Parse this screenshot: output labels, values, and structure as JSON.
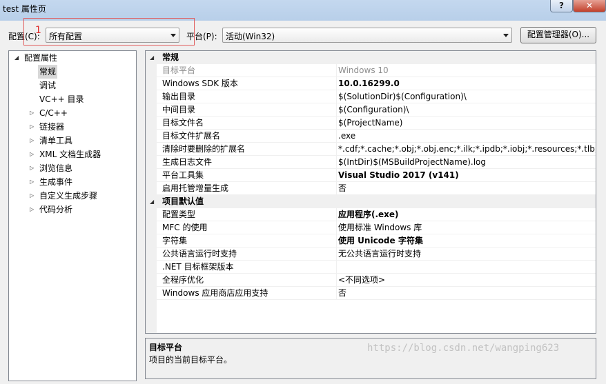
{
  "window": {
    "title": "test 属性页",
    "help_label": "?",
    "close_label": "✕"
  },
  "toolbar": {
    "config_label": "配置(C):",
    "config_value": "所有配置",
    "platform_label": "平台(P):",
    "platform_value": "活动(Win32)",
    "manager_button": "配置管理器(O)...",
    "annotation": "1"
  },
  "tree": {
    "items": [
      {
        "label": "配置属性",
        "expander": "◢"
      },
      {
        "label": "常规"
      },
      {
        "label": "调试"
      },
      {
        "label": "VC++ 目录"
      },
      {
        "label": "C/C++",
        "expander": "▷"
      },
      {
        "label": "链接器",
        "expander": "▷"
      },
      {
        "label": "清单工具",
        "expander": "▷"
      },
      {
        "label": "XML 文档生成器",
        "expander": "▷"
      },
      {
        "label": "浏览信息",
        "expander": "▷"
      },
      {
        "label": "生成事件",
        "expander": "▷"
      },
      {
        "label": "自定义生成步骤",
        "expander": "▷"
      },
      {
        "label": "代码分析",
        "expander": "▷"
      }
    ]
  },
  "grid": {
    "sections": [
      {
        "title": "常规",
        "expander": "◢",
        "rows": [
          {
            "name": "目标平台",
            "value": "Windows 10"
          },
          {
            "name": "Windows SDK 版本",
            "value": "10.0.16299.0"
          },
          {
            "name": "输出目录",
            "value": "$(SolutionDir)$(Configuration)\\"
          },
          {
            "name": "中间目录",
            "value": "$(Configuration)\\"
          },
          {
            "name": "目标文件名",
            "value": "$(ProjectName)"
          },
          {
            "name": "目标文件扩展名",
            "value": ".exe"
          },
          {
            "name": "清除时要删除的扩展名",
            "value": "*.cdf;*.cache;*.obj;*.obj.enc;*.ilk;*.ipdb;*.iobj;*.resources;*.tlb;*.tli;*.t"
          },
          {
            "name": "生成日志文件",
            "value": "$(IntDir)$(MSBuildProjectName).log"
          },
          {
            "name": "平台工具集",
            "value": "Visual Studio 2017 (v141)"
          },
          {
            "name": "启用托管增量生成",
            "value": "否"
          }
        ]
      },
      {
        "title": "项目默认值",
        "expander": "◢",
        "rows": [
          {
            "name": "配置类型",
            "value": "应用程序(.exe)"
          },
          {
            "name": "MFC 的使用",
            "value": "使用标准 Windows 库"
          },
          {
            "name": "字符集",
            "value": "使用 Unicode 字符集"
          },
          {
            "name": "公共语言运行时支持",
            "value": "无公共语言运行时支持"
          },
          {
            "name": ".NET 目标框架版本",
            "value": ""
          },
          {
            "name": "全程序优化",
            "value": "<不同选项>"
          },
          {
            "name": "Windows 应用商店应用支持",
            "value": "否"
          }
        ]
      }
    ]
  },
  "description": {
    "title": "目标平台",
    "text": "项目的当前目标平台。"
  },
  "watermark": "https://blog.csdn.net/wangping623"
}
